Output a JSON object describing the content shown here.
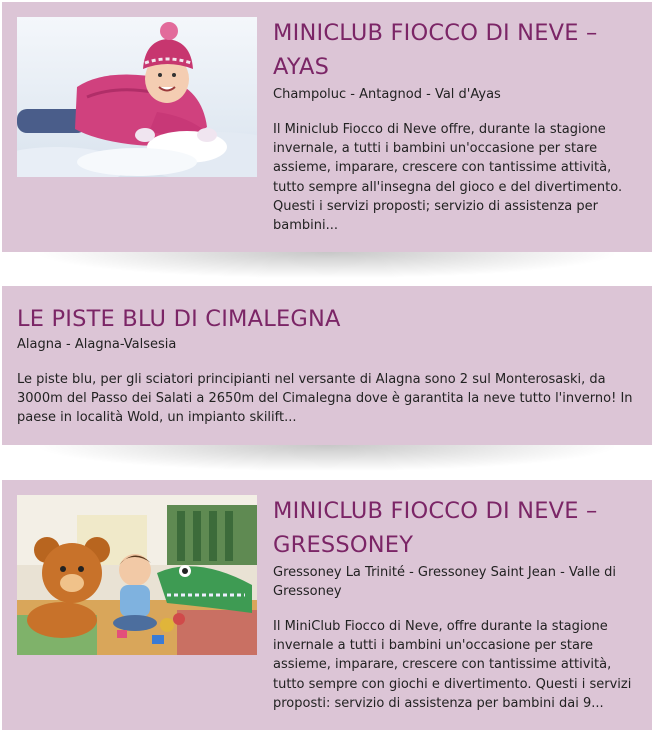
{
  "cards": [
    {
      "title": "MINICLUB FIOCCO DI NEVE – AYAS",
      "location": "Champoluc - Antagnod - Val d'Ayas",
      "description": "Il Miniclub Fiocco di Neve offre, durante la stagione invernale, a tutti i bambini un'occasione per stare assieme, imparare, crescere con tantissime attività, tutto sempre all'insegna del gioco e del divertimento. Questi i servizi proposti; servizio di assistenza per bambini..."
    },
    {
      "title": "LE PISTE BLU DI CIMALEGNA",
      "location": "Alagna - Alagna-Valsesia",
      "description": "Le piste blu, per gli sciatori principianti nel versante di Alagna sono 2 sul Monterosaski, da 3000m del Passo dei Salati a 2650m del Cimalegna dove è garantita la neve tutto l'inverno! In paese in località Wold, un impianto skilift..."
    },
    {
      "title": "MINICLUB FIOCCO DI NEVE – GRESSONEY",
      "location": "Gressoney La Trinité - Gressoney Saint Jean - Valle di Gressoney",
      "description": "Il MiniClub Fiocco di Neve, offre durante la stagione invernale a tutti i bambini un'occasione per stare assieme, imparare, crescere con tantissime attività, tutto sempre con giochi e divertimento. Questi i servizi proposti: servizio di assistenza per bambini dai 9..."
    }
  ],
  "colors": {
    "card_background": "#dcc5d6",
    "title": "#7b2566",
    "text": "#222222"
  }
}
